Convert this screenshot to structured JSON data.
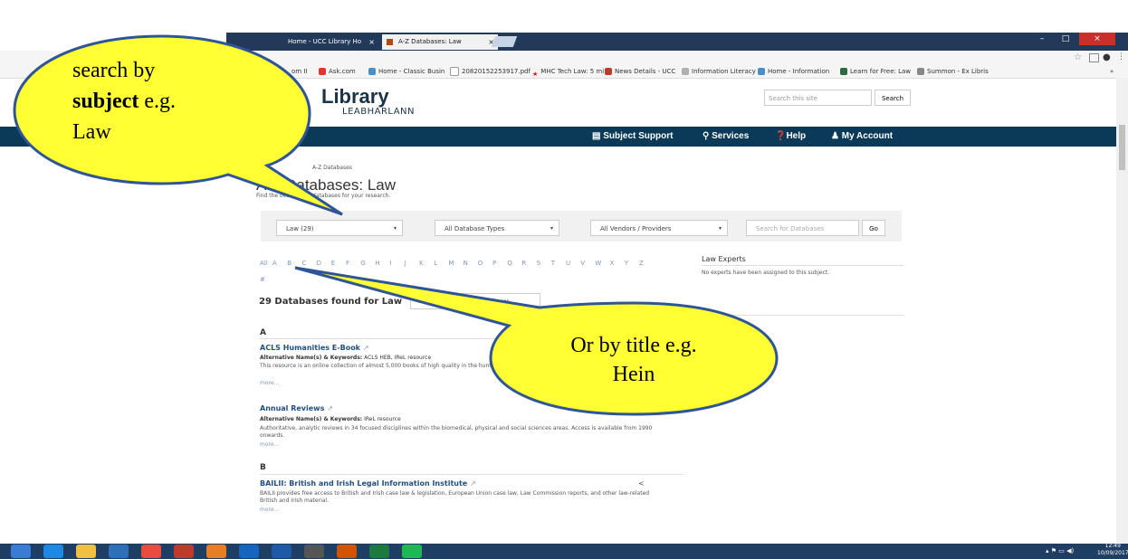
{
  "browser": {
    "tabs": [
      {
        "label": "Home - UCC Library Ho",
        "active": false
      },
      {
        "label": "A-Z Databases: Law",
        "active": true
      }
    ],
    "bookmarks": [
      {
        "label": "om II",
        "icon": "bookmark-icon",
        "color": "#777777"
      },
      {
        "label": "Ask.com",
        "icon": "ask-icon",
        "color": "#d83b2b"
      },
      {
        "label": "Home - Classic Busin",
        "icon": "cloud-icon",
        "color": "#4a90c8"
      },
      {
        "label": "20820152253917.pdf",
        "icon": "document-icon",
        "color": "#999999"
      },
      {
        "label": "MHC Tech Law: 5 mi",
        "icon": "star-icon",
        "color": "#d81b1b"
      },
      {
        "label": "News Details - UCC",
        "icon": "shield-icon",
        "color": "#c0392b"
      },
      {
        "label": "Information Literacy",
        "icon": "web-icon",
        "color": "#8a8a8a"
      },
      {
        "label": "Home - Information",
        "icon": "cloud-icon",
        "color": "#4a90c8"
      },
      {
        "label": "Learn for Free: Law",
        "icon": "tree-icon",
        "color": "#2a6b3f"
      },
      {
        "label": "Summon - Ex Libris",
        "icon": "summon-icon",
        "color": "#888888"
      }
    ]
  },
  "site": {
    "logo": "Library",
    "logo_sub": "LEABHARLANN",
    "search_placeholder": "Search this site",
    "search_button": "Search",
    "nav": [
      {
        "label": "Subject Support",
        "icon": "book-icon"
      },
      {
        "label": "Services",
        "icon": "search-icon"
      },
      {
        "label": "Help",
        "icon": "help-icon"
      },
      {
        "label": "My Account",
        "icon": "user-icon"
      }
    ]
  },
  "main": {
    "breadcrumb": "A-Z Databases",
    "title": "A-Z Databases: Law",
    "subtitle": "Find the best library databases for your research.",
    "filters": {
      "subject": "Law (29)",
      "type": "All Database Types",
      "vendor": "All Vendors / Providers",
      "search_placeholder": "Search for Databases",
      "go": "Go"
    },
    "letters": [
      "All",
      "A",
      "B",
      "C",
      "D",
      "E",
      "F",
      "G",
      "H",
      "I",
      "J",
      "K",
      "L",
      "M",
      "N",
      "O",
      "P",
      "Q",
      "R",
      "S",
      "T",
      "U",
      "V",
      "W",
      "X",
      "Y",
      "Z",
      "#"
    ],
    "found": "29 Databases found for Law",
    "clear_button": "Clear Filters / Show All Databases",
    "sections": [
      {
        "letter": "A",
        "entries": [
          {
            "title": "ACLS Humanities E-Book",
            "alt_label": "Alternative Name(s) & Keywords:",
            "alt": "ACLS HEB, IReL resource",
            "desc": "This resource is an online collection of almost 5,000 books of high quality in the humanities, available through individual subscription.",
            "more": "more..."
          },
          {
            "title": "Annual Reviews",
            "alt_label": "Alternative Name(s) & Keywords:",
            "alt": "IReL resource",
            "desc": "Authoritative, analytic reviews in 34 focused disciplines within the biomedical, physical and social sciences areas. Access is available from 1990 onwards.",
            "more": "more..."
          }
        ]
      },
      {
        "letter": "B",
        "entries": [
          {
            "title": "BAILII: British and Irish Legal Information Institute",
            "alt_label": "",
            "alt": "",
            "desc": "BAILII provides free access to British and Irish case law & legislation, European Union case law, Law Commission reports, and other law-related British and Irish material.",
            "more": "more..."
          }
        ]
      }
    ],
    "experts": {
      "title": "Law Experts",
      "text": "No experts have been assigned to this subject."
    }
  },
  "callouts": {
    "subject_lines": [
      "search by",
      "subject",
      " e.g.",
      "Law"
    ],
    "title_lines": [
      "Or by title e.g.",
      "Hein"
    ],
    "fill": "#ffff33",
    "stroke": "#2f5597"
  },
  "taskbar": {
    "apps": [
      "start-icon",
      "ie-icon",
      "explorer-icon",
      "media-icon",
      "chrome-icon",
      "language-icon",
      "firefox-icon",
      "outlook-icon",
      "word-icon",
      "hat-icon",
      "powerpoint-icon",
      "excel-icon",
      "spotify-icon"
    ],
    "clock_time": "12:49",
    "clock_date": "10/09/2017"
  }
}
